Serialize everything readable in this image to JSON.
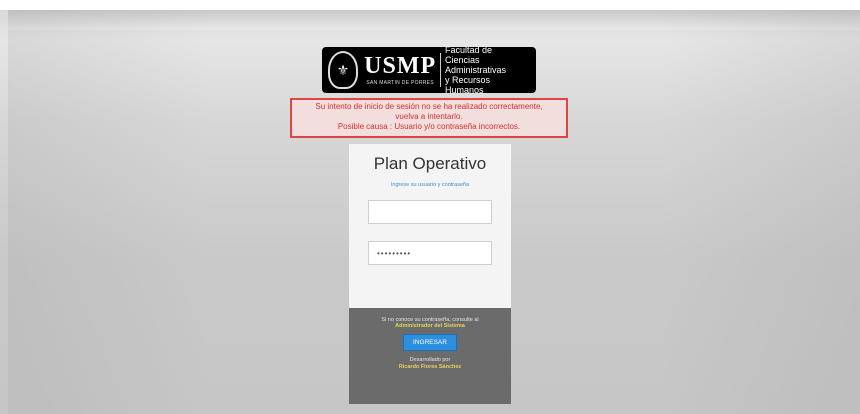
{
  "logo": {
    "icon": "usmp-seal-icon",
    "brand": "USMP",
    "brand_sub": "SAN MARTIN DE PORRES",
    "faculty_lines": [
      "Facultad de",
      "Ciencias Administrativas",
      "y Recursos Humanos"
    ]
  },
  "alert": {
    "line1": "Su intento de inicio de sesión no se ha realizado correctamente,",
    "line2": "vuelva a intentarlo.",
    "line3": "Posible causa : Usuario y/o contraseña incorrectos."
  },
  "login": {
    "title": "Plan Operativo",
    "hint": "Ingrese su usuario y contraseña",
    "username_value": "",
    "password_value": "•••••••••"
  },
  "footer": {
    "forgot_text": "Si no conoce su contraseña, consulte al",
    "admin_link": "Administrador del Sistema",
    "submit_label": "INGRESAR",
    "developed_by": "Desarrollado por",
    "developer": "Ricardo Flores Sánchez"
  }
}
